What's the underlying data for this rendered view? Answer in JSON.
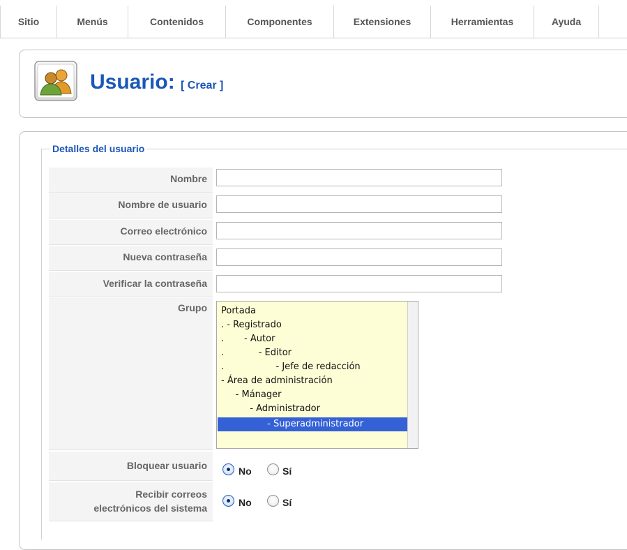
{
  "menu": {
    "items": [
      {
        "label": "Sitio"
      },
      {
        "label": "Menús"
      },
      {
        "label": "Contenidos"
      },
      {
        "label": "Componentes"
      },
      {
        "label": "Extensiones"
      },
      {
        "label": "Herramientas"
      },
      {
        "label": "Ayuda"
      }
    ]
  },
  "header": {
    "title": "Usuario:",
    "subtitle": "[ Crear ]",
    "icon": "users-icon"
  },
  "form": {
    "legend": "Detalles del usuario",
    "labels": {
      "name": "Nombre",
      "username": "Nombre de usuario",
      "email": "Correo electrónico",
      "new_password": "Nueva contraseña",
      "verify_password": "Verificar la contraseña",
      "group": "Grupo",
      "block_user": "Bloquear usuario",
      "receive_emails_line1": "Recibir correos",
      "receive_emails_line2": "electrónicos del sistema"
    },
    "values": {
      "name": "",
      "username": "",
      "email": "",
      "new_password": "",
      "verify_password": ""
    },
    "group_options": [
      {
        "label": "Portada"
      },
      {
        "label": ". - Registrado"
      },
      {
        "label": ".       - Autor"
      },
      {
        "label": ".            - Editor"
      },
      {
        "label": ".                  - Jefe de redacción"
      },
      {
        "label": "- Área de administración"
      },
      {
        "label": "     - Mánager"
      },
      {
        "label": "          - Administrador"
      },
      {
        "label": "                - Superadministrador"
      }
    ],
    "group_selected": "- Superadministrador",
    "radio_no": "No",
    "radio_yes": "Sí",
    "block_user_value": "No",
    "receive_emails_value": "No"
  },
  "colors": {
    "accent": "#1a57b6",
    "selection": "#3461d6",
    "list_background": "#fefed6"
  }
}
